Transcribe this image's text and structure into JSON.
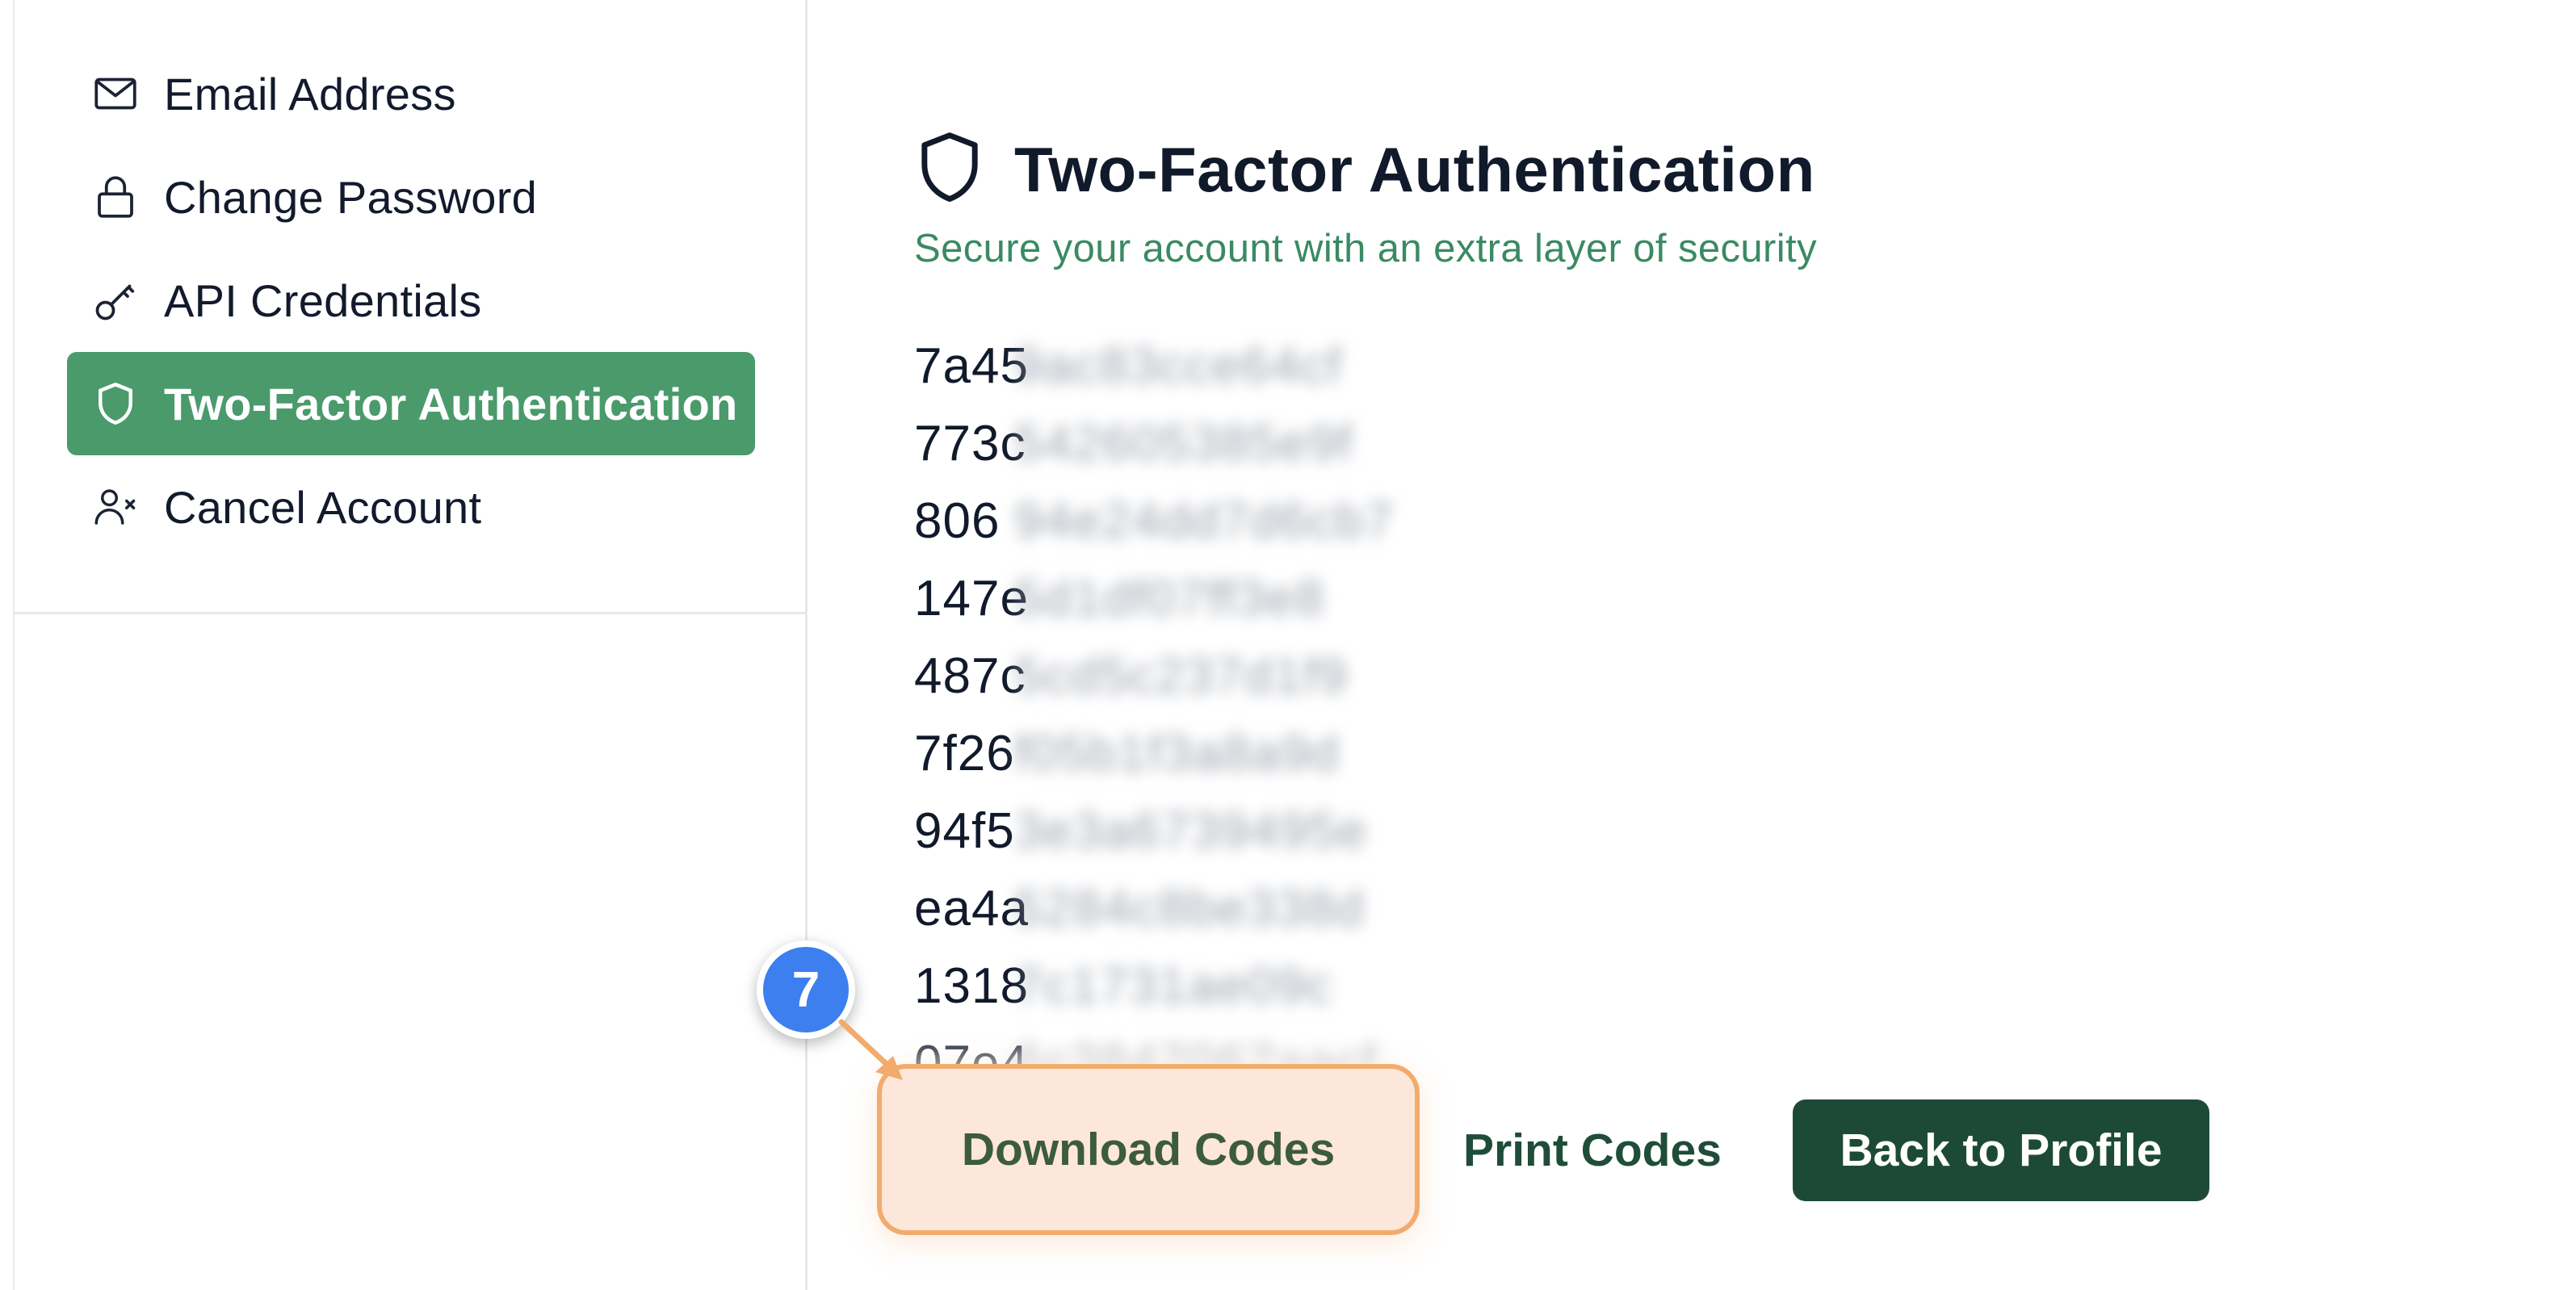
{
  "sidebar": {
    "items": [
      {
        "label": "Email Address",
        "icon": "mail-icon",
        "active": false
      },
      {
        "label": "Change Password",
        "icon": "lock-icon",
        "active": false
      },
      {
        "label": "API Credentials",
        "icon": "key-icon",
        "active": false
      },
      {
        "label": "Two-Factor Authentication",
        "icon": "shield-icon",
        "active": true
      },
      {
        "label": "Cancel Account",
        "icon": "user-remove-icon",
        "active": false
      }
    ]
  },
  "main": {
    "title": "Two-Factor Authentication",
    "subtitle": "Secure your account with an extra layer of security",
    "backup_codes": [
      {
        "prefix": "7a45",
        "rest": "9ac83cce64cf"
      },
      {
        "prefix": "773c",
        "rest": "542605385e9f"
      },
      {
        "prefix": "806",
        "rest": "94e24dd7d6cb7"
      },
      {
        "prefix": "147e",
        "rest": "5d1df07ff3e8"
      },
      {
        "prefix": "487c",
        "rest": "5cd5c237d1f9"
      },
      {
        "prefix": "7f26",
        "rest": "f05b1f3a8a9d"
      },
      {
        "prefix": "94f5",
        "rest": "3e3a6739495e"
      },
      {
        "prefix": "ea4a",
        "rest": "5284c8be338d"
      },
      {
        "prefix": "1318",
        "rest": "7c1731ae09c"
      },
      {
        "prefix": "07e4",
        "rest": "6c3847067aacf"
      }
    ],
    "buttons": {
      "download": "Download Codes",
      "print": "Print Codes",
      "back": "Back to Profile"
    }
  },
  "annotation": {
    "step_number": "7"
  },
  "colors": {
    "active_nav": "#4a9a6c",
    "subtitle": "#3a8a63",
    "back_button": "#1d4a36",
    "highlight_border": "#f2ab6d",
    "highlight_fill": "#fde7da",
    "step_badge": "#3d7fee"
  }
}
